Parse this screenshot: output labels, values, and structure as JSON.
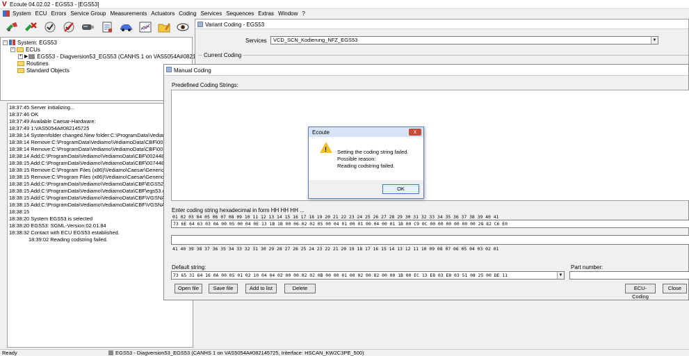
{
  "window": {
    "title": "Ecoute 04.02.02 - EGS53 - [EGS53]"
  },
  "menu": [
    "System",
    "ECU",
    "Errors",
    "Service Group",
    "Measurements",
    "Actuators",
    "Coding",
    "Services",
    "Sequences",
    "Extras",
    "Window",
    "?"
  ],
  "toolbar": {
    "icons": [
      "connect-icon",
      "disconnect-icon",
      "check-icon",
      "no-check-icon",
      "usb-device-icon",
      "report-icon",
      "car-icon",
      "chart-icon",
      "folder-edit-icon",
      "eye-icon"
    ]
  },
  "tree": {
    "system": "System: EGS53",
    "ecus": "ECUs",
    "ecu": "EGS53 - Diagversion53_EGS53 (CANHS 1 on VAS5054A#082145725,",
    "routines": "Routines",
    "objects": "Standard Objects"
  },
  "log": [
    "18:37:45 Server initializing...",
    "18:37:46 OK",
    "18:37:49 Available Caesar-Hardware:",
    "18:37:49 1:VAS5054A#082145725",
    "18:38:14 Systemfolder changed.New folder:C:\\ProgramData\\Vediamo",
    "18:38:14 Remove:C:\\ProgramData\\Vediamo\\VediamoData\\CBF\\00244",
    "18:38:14 Remove:C:\\ProgramData\\Vediamo\\VediamoData\\CBF\\00744",
    "18:38:14 Add:C:\\ProgramData\\Vediamo\\VediamoData\\CBF\\00244869",
    "18:38:15 Add:C:\\ProgramData\\Vediamo\\VediamoData\\CBF\\00744807",
    "18:38:15 Remove:C:\\Program Files (x86)\\Vediamo\\Caesar\\Generic\\BS",
    "18:38:15 Remove:C:\\Program Files (x86)\\Vediamo\\Caesar\\Generic\\BS",
    "18:38:15 Add:C:\\ProgramData\\Vediamo\\VediamoData\\CBF\\EGS52.cbf",
    "18:38:15 Add:C:\\ProgramData\\Vediamo\\VediamoData\\CBF\\egs53.cbf",
    "18:38:15 Add:C:\\ProgramData\\Vediamo\\VediamoData\\CBF\\VGSNAG2",
    "18:38:15 Add:C:\\ProgramData\\Vediamo\\VediamoData\\CBF\\VGSNAG3",
    "18:38:15",
    "18:38:20 System EGS53 is selected",
    "18:38:20 EGS53: SGML-Version:02.01.84",
    "18:38:32 Contact with ECU EGS53 established.",
    "18:39:02 Reading codstring failed."
  ],
  "variant": {
    "title": "Variant Coding - EGS53",
    "services_label": "Services",
    "services_value": "VCD_SCN_Kodierung_NFZ_EGS53",
    "current_coding_label": "Current Coding"
  },
  "manual": {
    "title": "Manual Coding",
    "predefined_label": "Predefined Coding Strings:",
    "enter_label": "Enter coding string hexadecimal in form HH HH HH ...",
    "index_row": "01 02 03 04 05 06 07 08 09 10 11 12 13 14 15 16 17 18 19 20 21 22 23 24 25 26 27 28 29 30 31 32 33 34 35 36 37 38 39 40 41",
    "coding_value": "73 6E 64 63 03 0A 00 05 00 04 0E 13 1B 1B 00 06 02 02 05 00 04 01 00 01 00 04 00 01 1B 00 C9 0C 00 00 00 00 00 00 28 82 C6 E0",
    "reverse_index_row": "41 40 39 38 37 36 35 34 33 32 31 30 29 28 27 26 25 24 23 22 21 20 19 18 17 16 15 14 13 12 11 10 09 08 07 06 05 04 03 02 01",
    "default_label": "Default string:",
    "default_value": "73 65 31 64 16 0A 00 05 01 02 10 04 04 02 00 00 02 02 0B 00 00 01 00 02 00 82 00 00 1B 00 EC 13 E8 03 E8 03 51 08 25 00 DE 11",
    "part_label": "Part number:",
    "buttons": {
      "open": "Open file",
      "save": "Save file",
      "add": "Add to list",
      "delete": "Delete",
      "ecu": "ECU-Coding",
      "close": "Close"
    }
  },
  "dialog": {
    "title": "Ecoute",
    "line1": "Setting the coding string failed.",
    "line2": "Possible reason:",
    "line3": "Reading codstring failed.",
    "ok": "OK",
    "close_symbol": "x"
  },
  "status": {
    "ready": "Ready",
    "info": "EGS53 - Diagversion53_EGS53 (CANHS 1 on VAS5054A#082145725, Interface: HSCAN_KW2C3PE_500)"
  },
  "colors": {
    "accent": "#3a6fd0",
    "warning": "#f2c029",
    "close_red": "#c84a3a"
  }
}
